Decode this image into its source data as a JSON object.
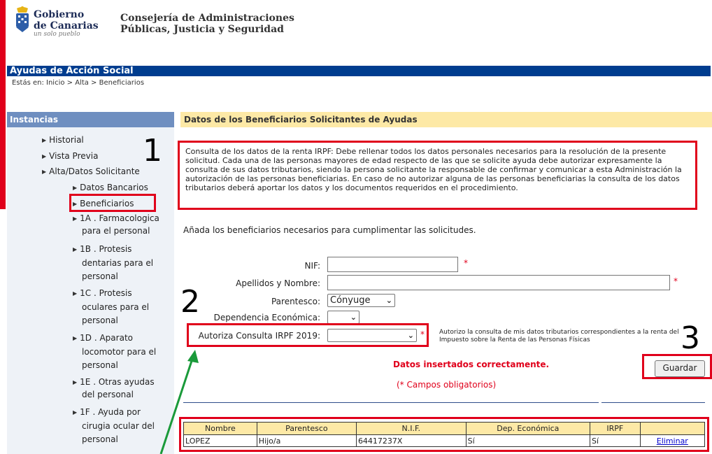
{
  "header": {
    "gobierno_line1": "Gobierno",
    "gobierno_line2": "de Canarias",
    "gobierno_tagline": "un solo pueblo",
    "consejeria_line1": "Consejería de Administraciones",
    "consejeria_line2": "Públicas, Justicia y Seguridad"
  },
  "app_title": "Ayudas de Acción Social",
  "breadcrumb": "Estás en: Inicio > Alta > Beneficiarios",
  "sidebar": {
    "title": "Instancias",
    "items": [
      {
        "label": "Historial"
      },
      {
        "label": "Vista Previa"
      },
      {
        "label": "Alta/Datos Solicitante"
      },
      {
        "label": "Datos Bancarios"
      },
      {
        "label": "Beneficiarios"
      },
      {
        "label_1": "1A . Farmacologica",
        "label_2": "para el personal"
      },
      {
        "label_1": "1B . Protesis",
        "label_2": "dentarias para el",
        "label_3": "personal"
      },
      {
        "label_1": "1C . Protesis",
        "label_2": "oculares para el",
        "label_3": "personal"
      },
      {
        "label_1": "1D . Aparato",
        "label_2": "locomotor para el",
        "label_3": "personal"
      },
      {
        "label_1": "1E . Otras ayudas",
        "label_2": "del personal"
      },
      {
        "label_1": "1F . Ayuda por",
        "label_2": "cirugia ocular del",
        "label_3": "personal"
      }
    ]
  },
  "main": {
    "title": "Datos de los Beneficiarios Solicitantes de Ayudas",
    "notice": "Consulta de los datos de la renta IRPF: Debe rellenar todos los datos personales necesarios para la resolución de la presente solicitud. Cada una de las personas mayores de edad respecto de las que se solicite ayuda debe autorizar expresamente la consulta de sus datos tributarios, siendo la persona solicitante la responsable de confirmar y comunicar a esta Administración la autorización de las personas beneficiarias. En caso de no autorizar alguna de las personas beneficiarias la consulta de los datos tributarios deberá aportar los datos y los documentos requeridos en el procedimiento.",
    "instructions": "Añada los beneficiarios necesarios para cumplimentar las solicitudes.",
    "form": {
      "nif_label": "NIF:",
      "nif_value": "",
      "nombre_label": "Apellidos y Nombre:",
      "nombre_value": "",
      "parentesco_label": "Parentesco:",
      "parentesco_value": "Cónyuge",
      "dependencia_label": "Dependencia Económica:",
      "dependencia_value": "",
      "autoriza_label": "Autoriza Consulta IRPF 2019:",
      "autoriza_value": "",
      "autoriza_note": "Autorizo la consulta de mis datos tributarios correspondientes a la renta del Impuesto sobre la Renta de las Personas Físicas",
      "required_mark": "*"
    },
    "success_message": "Datos insertados correctamente.",
    "required_note": "(* Campos obligatorios)",
    "save_label": "Guardar",
    "table": {
      "headers": [
        "Nombre",
        "Parentesco",
        "N.I.F.",
        "Dep. Económica",
        "IRPF",
        ""
      ],
      "rows": [
        {
          "nombre": "LOPEZ",
          "parentesco": "Hijo/a",
          "nif": "64417237X",
          "dep": "Sí",
          "irpf": "Sí",
          "action": "Eliminar"
        }
      ]
    }
  },
  "annotations": {
    "n1": "1",
    "n2": "2",
    "n3": "3",
    "color": "#e0001b",
    "arrow_color": "#1a9a3a"
  },
  "icons": {
    "crest": "coat-of-arms-icon",
    "nav_bullet": "triangle-right-icon",
    "dropdown": "chevron-down-icon"
  }
}
